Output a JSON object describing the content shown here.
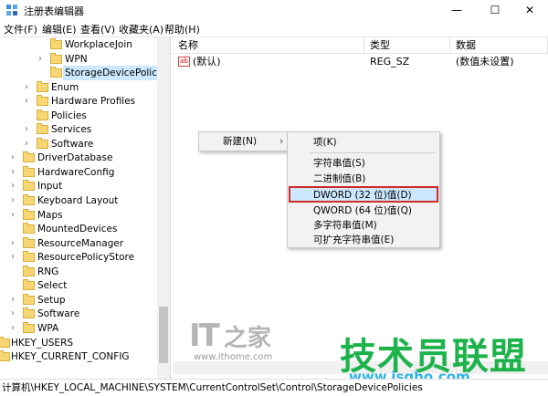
{
  "window": {
    "title": "注册表编辑器",
    "minimize": "—",
    "maximize": "☐",
    "close": "✕"
  },
  "menu": [
    "文件(F)",
    "编辑(E)",
    "查看(V)",
    "收藏夹(A)",
    "帮助(H)"
  ],
  "tree": {
    "items": [
      {
        "label": "WorkplaceJoin",
        "expander": ""
      },
      {
        "label": "WPN",
        "expander": "›"
      },
      {
        "label": "StorageDevicePolicies",
        "expander": ""
      },
      {
        "label": "Enum",
        "expander": "›"
      },
      {
        "label": "Hardware Profiles",
        "expander": "›"
      },
      {
        "label": "Policies",
        "expander": ""
      },
      {
        "label": "Services",
        "expander": "›"
      },
      {
        "label": "Software",
        "expander": "›"
      },
      {
        "label": "DriverDatabase",
        "expander": "›"
      },
      {
        "label": "HardwareConfig",
        "expander": "›"
      },
      {
        "label": "Input",
        "expander": "›"
      },
      {
        "label": "Keyboard Layout",
        "expander": "›"
      },
      {
        "label": "Maps",
        "expander": "›"
      },
      {
        "label": "MountedDevices",
        "expander": ""
      },
      {
        "label": "ResourceManager",
        "expander": "›"
      },
      {
        "label": "ResourcePolicyStore",
        "expander": "›"
      },
      {
        "label": "RNG",
        "expander": ""
      },
      {
        "label": "Select",
        "expander": ""
      },
      {
        "label": "Setup",
        "expander": "›"
      },
      {
        "label": "Software",
        "expander": "›"
      },
      {
        "label": "WPA",
        "expander": "›"
      },
      {
        "label": "HKEY_USERS",
        "expander": "›"
      },
      {
        "label": "HKEY_CURRENT_CONFIG",
        "expander": "›"
      }
    ]
  },
  "columns": [
    "名称",
    "类型",
    "数据"
  ],
  "values": [
    {
      "icon": "ab",
      "name": "(默认)",
      "type": "REG_SZ",
      "data": "(数值未设置)"
    }
  ],
  "context_menu": {
    "new_label": "新建(N)",
    "submenu": [
      "项(K)",
      "字符串值(S)",
      "二进制值(B)",
      "DWORD (32 位)值(D)",
      "QWORD (64 位)值(Q)",
      "多字符串值(M)",
      "可扩充字符串值(E)"
    ]
  },
  "status_path": "计算机\\HKEY_LOCAL_MACHINE\\SYSTEM\\CurrentControlSet\\Control\\StorageDevicePolicies",
  "watermarks": {
    "it_logo": "IT",
    "it_logo_char": "之家",
    "ithome_url": "www.ithome.com",
    "brand": "技术员联盟",
    "brand_url": "www.jsgho.com"
  },
  "colors": {
    "selection": "#cce8ff",
    "highlight_border": "#d12b2b",
    "brand_green": "#1db34a",
    "brand_blue": "#2db3e8"
  }
}
